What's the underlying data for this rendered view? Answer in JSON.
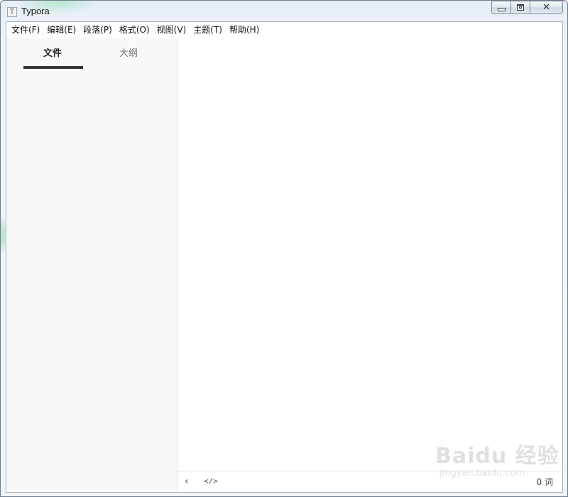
{
  "window": {
    "title": "Typora",
    "app_icon_letter": "T",
    "controls": {
      "minimize_icon": "minimize-icon",
      "maximize_icon": "maximize-icon",
      "close_icon": "close-icon",
      "close_glyph": "✕"
    }
  },
  "menubar": {
    "items": [
      {
        "label": "文件(F)"
      },
      {
        "label": "编辑(E)"
      },
      {
        "label": "段落(P)"
      },
      {
        "label": "格式(O)"
      },
      {
        "label": "视图(V)"
      },
      {
        "label": "主题(T)"
      },
      {
        "label": "帮助(H)"
      }
    ]
  },
  "sidebar": {
    "tabs": [
      {
        "label": "文件",
        "active": true
      },
      {
        "label": "大纲",
        "active": false
      }
    ]
  },
  "editor": {
    "content": ""
  },
  "footer": {
    "toggle_sidebar_glyph": "‹",
    "source_mode_glyph": "</>",
    "word_count": "0 词"
  },
  "watermark": {
    "logo_text": "Baidu 经验",
    "url": "jingyan.baidu.com"
  },
  "colors": {
    "active_tab_indicator": "#333333",
    "sidebar_background": "#f8f8f8",
    "editor_background": "#ffffff"
  }
}
